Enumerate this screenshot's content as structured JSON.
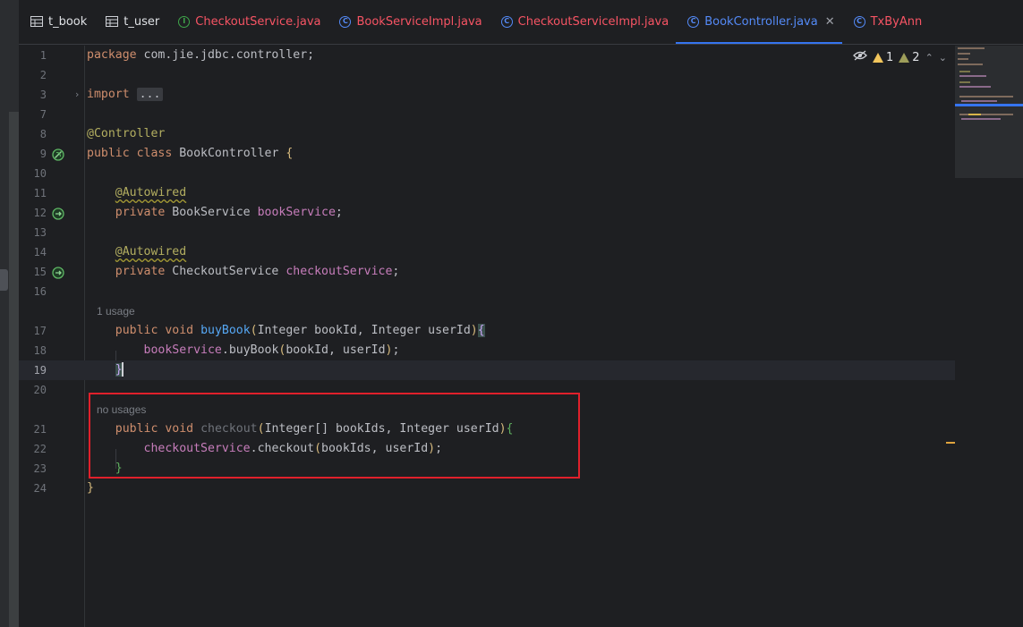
{
  "tabs": [
    {
      "label": "t_book",
      "icon": "table-icon",
      "color": "#dfe1e5",
      "active": false
    },
    {
      "label": "t_user",
      "icon": "table-icon",
      "color": "#dfe1e5",
      "active": false
    },
    {
      "label": "CheckoutService.java",
      "icon": "interface-icon",
      "color": "#f75464",
      "active": false
    },
    {
      "label": "BookServiceImpl.java",
      "icon": "class-icon",
      "color": "#f75464",
      "active": false
    },
    {
      "label": "CheckoutServiceImpl.java",
      "icon": "class-icon",
      "color": "#f75464",
      "active": false
    },
    {
      "label": "BookController.java",
      "icon": "class-icon",
      "color": "#548af7",
      "active": true
    },
    {
      "label": "TxByAnn",
      "icon": "class-icon",
      "color": "#f75464",
      "active": false
    }
  ],
  "inspection": {
    "warnings": "1",
    "weak_warnings": "2"
  },
  "code": {
    "l1_pkg_kw": "package",
    "l1_pkg": " com.jie.jdbc.controller;",
    "l3_import": "import",
    "l3_fold": "...",
    "l8_ann": "@Controller",
    "l9_public": "public",
    "l9_class": "class",
    "l9_name": " BookController ",
    "l9_brace": "{",
    "l11_ann": "@Autowired",
    "l12_private": "private",
    "l12_type": " BookService ",
    "l12_field": "bookService",
    "l12_semi": ";",
    "l14_ann": "@Autowired",
    "l15_private": "private",
    "l15_type": " CheckoutService ",
    "l15_field": "checkoutService",
    "l15_semi": ";",
    "hint_1": "1 usage",
    "l17_public": "public",
    "l17_void": "void",
    "l17_name": "buyBook",
    "l17_op": "(",
    "l17_params": "Integer bookId, Integer userId",
    "l17_cp": ")",
    "l17_ob": "{",
    "l18_field": "bookService",
    "l18_call": ".buyBook",
    "l18_op": "(",
    "l18_args": "bookId, userId",
    "l18_cp": ")",
    "l18_semi": ";",
    "l19_cb": "}",
    "hint_2": "no usages",
    "l21_public": "public",
    "l21_void": "void",
    "l21_name": "checkout",
    "l21_op": "(",
    "l21_p1": "Integer[] bookIds, Integer userId",
    "l21_cp": ")",
    "l21_ob": "{",
    "l22_field": "checkoutService",
    "l22_call": ".checkout",
    "l22_op": "(",
    "l22_args": "bookIds, userId",
    "l22_cp": ")",
    "l22_semi": ";",
    "l23_cb": "}",
    "l24_cb": "}"
  },
  "line_numbers": [
    "1",
    "2",
    "3",
    "7",
    "8",
    "9",
    "10",
    "11",
    "12",
    "13",
    "14",
    "15",
    "16",
    "17",
    "18",
    "19",
    "20",
    "21",
    "22",
    "23",
    "24"
  ]
}
